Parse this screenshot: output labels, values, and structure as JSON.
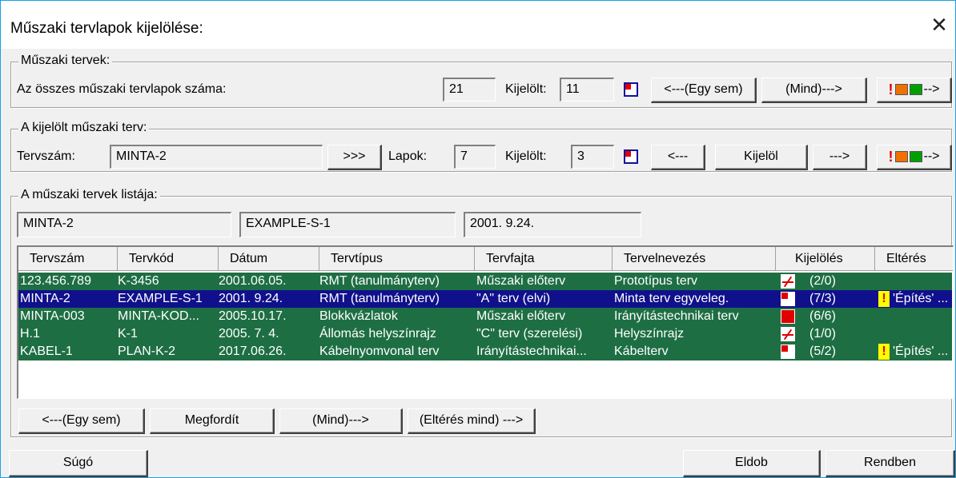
{
  "window": {
    "title": "Műszaki tervlapok kijelölése:",
    "close_glyph": "✕"
  },
  "tervek": {
    "group_label": "Műszaki tervek:",
    "total_label": "Az összes műszaki tervlapok száma:",
    "total_value": "21",
    "selected_label": "Kijelölt:",
    "selected_value": "11",
    "none_button": "<---(Egy sem)",
    "all_button": "(Mind)--->",
    "extra_button_arrow": "-->"
  },
  "kijelolt": {
    "group_label": "A kijelölt műszaki terv:",
    "number_label": "Tervszám:",
    "number_value": "MINTA-2",
    "browse_button": ">>>",
    "pages_label": "Lapok:",
    "pages_value": "7",
    "selected_label": "Kijelölt:",
    "selected_value": "3",
    "prev_button": "<---",
    "select_button": "Kijelöl",
    "next_button": "--->",
    "extra_button_arrow": "-->"
  },
  "lista": {
    "group_label": "A műszaki tervek listája:",
    "filter_number": "MINTA-2",
    "filter_code": "EXAMPLE-S-1",
    "filter_date": "2001. 9.24.",
    "columns": [
      "Tervszám",
      "Tervkód",
      "Dátum",
      "Tervtípus",
      "Tervfajta",
      "Tervelnevezés",
      "Kijelölés",
      "Eltérés"
    ],
    "rows": [
      {
        "number": "123.456.789",
        "code": "K-3456",
        "date": "2001.06.05.",
        "type": "RMT (tanulmányterv)",
        "kind": "Műszaki előterv",
        "name": "Prototípus terv",
        "icon": "none",
        "count": "(2/0)",
        "warn": false,
        "diff": "",
        "selected": false
      },
      {
        "number": "MINTA-2",
        "code": "EXAMPLE-S-1",
        "date": "2001. 9.24.",
        "type": "RMT (tanulmányterv)",
        "kind": "\"A\" terv (elvi)",
        "name": "Minta terv egyveleg.",
        "icon": "partial",
        "count": "(7/3)",
        "warn": true,
        "diff": "'Építés' ...",
        "selected": true
      },
      {
        "number": "MINTA-003",
        "code": "MINTA-KOD...",
        "date": "2005.10.17.",
        "type": "Blokkvázlatok",
        "kind": "Műszaki előterv",
        "name": "Irányítástechnikai terv",
        "icon": "full",
        "count": "(6/6)",
        "warn": false,
        "diff": "",
        "selected": false
      },
      {
        "number": "H.1",
        "code": "K-1",
        "date": "2005. 7. 4.",
        "type": "Állomás helyszínrajz",
        "kind": "\"C\" terv (szerelési)",
        "name": "Helyszínrajz",
        "icon": "none",
        "count": "(1/0)",
        "warn": false,
        "diff": "",
        "selected": false
      },
      {
        "number": "KABEL-1",
        "code": "PLAN-K-2",
        "date": "2017.06.26.",
        "type": "Kábelnyomvonal terv",
        "kind": "Irányítástechnikai...",
        "name": "Kábelterv",
        "icon": "partial",
        "count": "(5/2)",
        "warn": true,
        "diff": "'Építés' ...",
        "selected": false
      }
    ],
    "warn_glyph": "!",
    "none_button": "<---(Egy sem)",
    "invert_button": "Megfordít",
    "all_button": "(Mind)--->",
    "diff_all_button": "(Eltérés mind) --->"
  },
  "footer": {
    "help_button": "Súgó",
    "discard_button": "Eldob",
    "ok_button": "Rendben"
  },
  "colors": {
    "row_bg": "#1e6e44",
    "row_selected_bg": "#10108c",
    "accent_red": "#e00000",
    "accent_green": "#00a000",
    "accent_orange": "#f07000"
  }
}
